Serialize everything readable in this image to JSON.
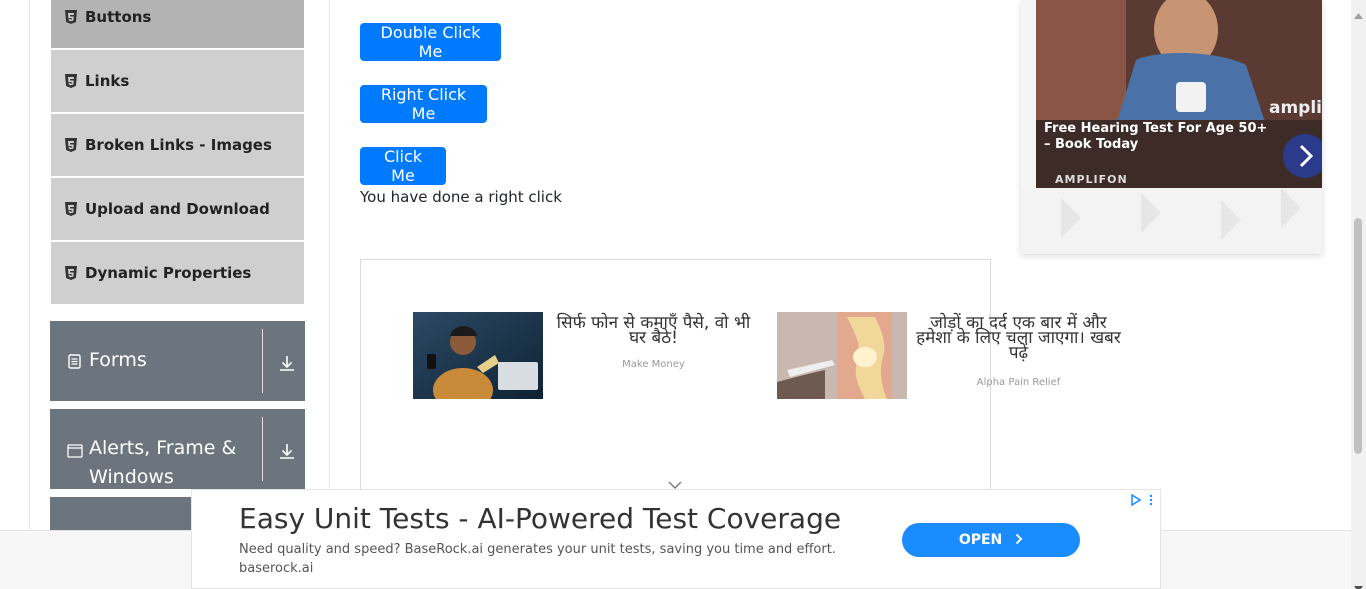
{
  "sidebar": {
    "sub_items": [
      {
        "label": "Buttons",
        "icon": "html5-icon"
      },
      {
        "label": "Links",
        "icon": "html5-icon"
      },
      {
        "label": "Broken Links - Images",
        "icon": "html5-icon"
      },
      {
        "label": "Upload and Download",
        "icon": "html5-icon"
      },
      {
        "label": "Dynamic Properties",
        "icon": "html5-icon"
      }
    ],
    "groups": [
      {
        "label": "Forms",
        "icon": "document-icon"
      },
      {
        "label_line1": "Alerts, Frame &",
        "label_line2": "Windows",
        "icon": "window-icon"
      }
    ]
  },
  "main": {
    "double_click_label": "Double Click Me",
    "right_click_label": "Right Click Me",
    "click_label": "Click Me",
    "result_message": "You have done a right click"
  },
  "inline_ad": {
    "items": [
      {
        "title": "सिर्फ फोन से कमाएँ पैसे, वो भी घर बैठे!",
        "source": "Make Money"
      },
      {
        "title": "जोड़ों का दर्द एक बार में और हमेशा के लिए चला जाएगा। खबर पढ़ें",
        "source": "Alpha Pain Relief"
      }
    ]
  },
  "right_ad": {
    "title": "Free Hearing Test For Age 50+ – Book Today",
    "brand": "AMPLIFON",
    "logo": "amplifon"
  },
  "bottom_ad": {
    "title": "Easy Unit Tests - AI-Powered Test Coverage",
    "description": "Need quality and speed? BaseRock.ai generates your unit tests, saving you time and effort.",
    "domain": "baserock.ai",
    "open_label": "OPEN"
  },
  "colors": {
    "primary": "#007bff",
    "sidebar_group": "#6c757d",
    "sidebar_item": "#cfcfcf",
    "sidebar_active": "#b3b3b3"
  }
}
